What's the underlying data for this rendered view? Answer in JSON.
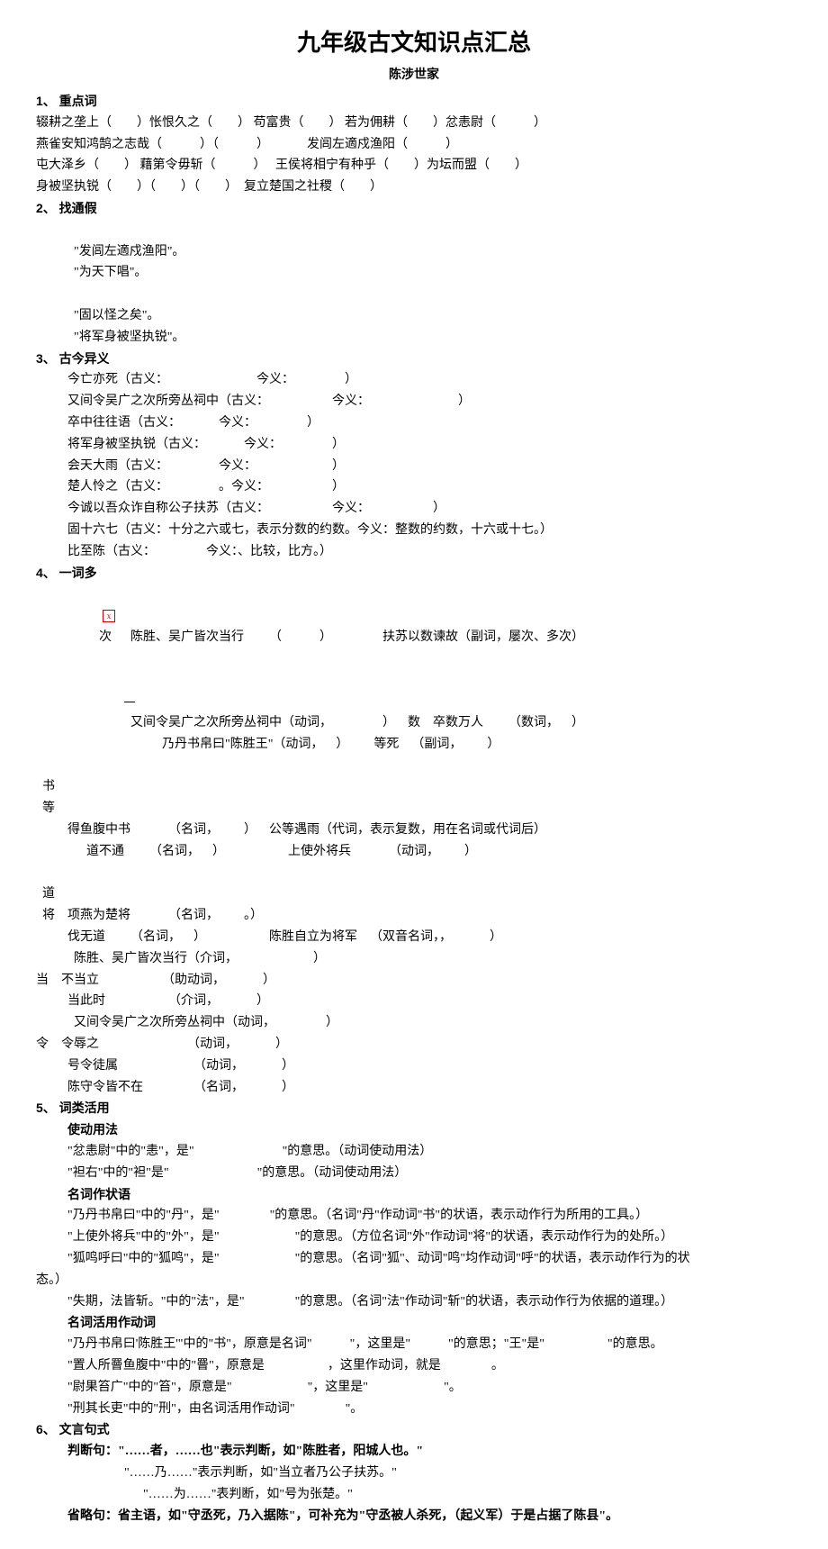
{
  "title": "九年级古文知识点汇总",
  "subtitle": "陈涉世家",
  "s1": {
    "head": "1、 重点词",
    "l1": "辍耕之垄上（        ）怅恨久之（        ） 苟富贵（        ） 若为佣耕（        ）忿恚尉（            ）",
    "l2": "燕雀安知鸿鹄之志哉（            ）（            ）            发闾左適戍渔阳（            ）",
    "l3": "屯大泽乡（        ） 藉第令毋斩（            ）   王侯将相宁有种乎（        ）为坛而盟（        ）",
    "l4": "身被坚执锐（        ）（        ）（        ）  复立楚国之社稷（        ）"
  },
  "s2": {
    "head": "2、 找通假",
    "l1a": "\"发闾左適戍渔阳\"。",
    "l1b": "\"为天下唱\"。",
    "l2a": "\"固以怪之矣\"。",
    "l2b": "\"将军身被坚执锐\"。"
  },
  "s3": {
    "head": "3、 古今异义",
    "l1": "今亡亦死（古义：                            今义：                ）",
    "l2": "又间令吴广之次所旁丛祠中（古义：                    今义：                            ）",
    "l3": "卒中往往语（古义：            今义：                ）",
    "l4": "将军身被坚执锐（古义：            今义：                ）",
    "l5": "会天大雨（古义：                今义：                        ）",
    "l6": "楚人怜之（古义：                。今义：                    ）",
    "l7": "今诚以吾众诈自称公子扶苏（古义：                    今义：                    ）",
    "l8": "固十六七（古义：十分之六或七，表示分数的约数。今义：整数的约数，十六或十七。）",
    "l9": "比至陈（古义：                今义：、比较，比方。）"
  },
  "s4": {
    "head": "4、 一词多",
    "l1": "次      陈胜、吴广皆次当行        （            ）                扶苏以数谏故（副词，屡次、多次）",
    "l2": "又间令吴广之次所旁丛祠中（动词，                ）    数    卒数万人        （数词，    ）",
    "l3": "乃丹书帛曰\"陈胜王\"（动词，    ）        等死    （副词，        ）",
    "l4a": "书",
    "l4b": "等",
    "l5": "得鱼腹中书            （名词，        ）    公等遇雨（代词，表示复数，用在名词或代词后）",
    "l6": "道不通        （名词，    ）                    上使外将兵            （动词，        ）",
    "l7a": "道",
    "l7b": "将    项燕为楚将            （名词，        。）",
    "l8": "伐无道        （名词，    ）                    陈胜自立为将军    （双音名词，，            ）",
    "l9": "陈胜、吴广皆次当行（介词，                        ）",
    "l10": "当    不当立                    （助动词，            ）",
    "l11": "当此时                    （介词，            ）",
    "l12": "又间令吴广之次所旁丛祠中（动词，                ）",
    "l13": "令    令辱之                            （动词，            ）",
    "l14": "号令徒属                        （动词，            ）",
    "l15": "陈守令皆不在                （名词，            ）"
  },
  "s5": {
    "head": "5、 词类活用",
    "sub1": "使动用法",
    "l1": "\"忿恚尉\"中的\"恚\"，是\"                            \"的意思。（动词使动用法）",
    "l2": "\"袒右\"中的\"袒\"是\"                            \"的意思。（动词使动用法）",
    "sub2": "名词作状语",
    "l3": "\"乃丹书帛曰\"中的\"丹\"，是\"                \"的意思。（名词\"丹\"作动词\"书\"的状语，表示动作行为所用的工具。）",
    "l4": "\"上使外将兵\"中的\"外\"，是\"                        \"的意思。（方位名词\"外\"作动词\"将\"的状语，表示动作行为的处所。）",
    "l5a": "\"狐鸣呼曰\"中的\"狐鸣\"，是\"                        \"的意思。（名词\"狐\"、动词\"鸣\"均作动词\"呼\"的状语，表示动作行为的状",
    "l5b": "态。）",
    "l6": "\"失期，法皆斩。\"中的\"法\"，是\"                \"的意思。（名词\"法\"作动词\"斩\"的状语，表示动作行为依据的道理。）",
    "sub3": "名词活用作动词",
    "l7": "\"乃丹书帛曰'陈胜王'\"中的\"书\"，原意是名词\"            \"，这里是\"            \"的意思；\"王\"是\"                    \"的意思。",
    "l8": "\"置人所罾鱼腹中\"中的\"罾\"，原意是                    ，这里作动词，就是                。",
    "l9": "\"尉果笞广\"中的\"笞\"，原意是\"                        \"，这里是\"                        \"。",
    "l10": "\"刑其长吏\"中的\"刑\"，由名词活用作动词\"                \"。"
  },
  "s6": {
    "head": "6、 文言句式",
    "l1": "判断句：\"……者，……也\"表示判断，如\"陈胜者，阳城人也。\"",
    "l2": "\"……乃……\"表示判断，如\"当立者乃公子扶苏。\"",
    "l3": "\"……为……\"表判断，如\"号为张楚。\"",
    "l4": "省略句：省主语，如\"守丞死，乃入据陈\"，可补充为\"守丞被人杀死，（起义军）于是占据了陈县\"。"
  }
}
